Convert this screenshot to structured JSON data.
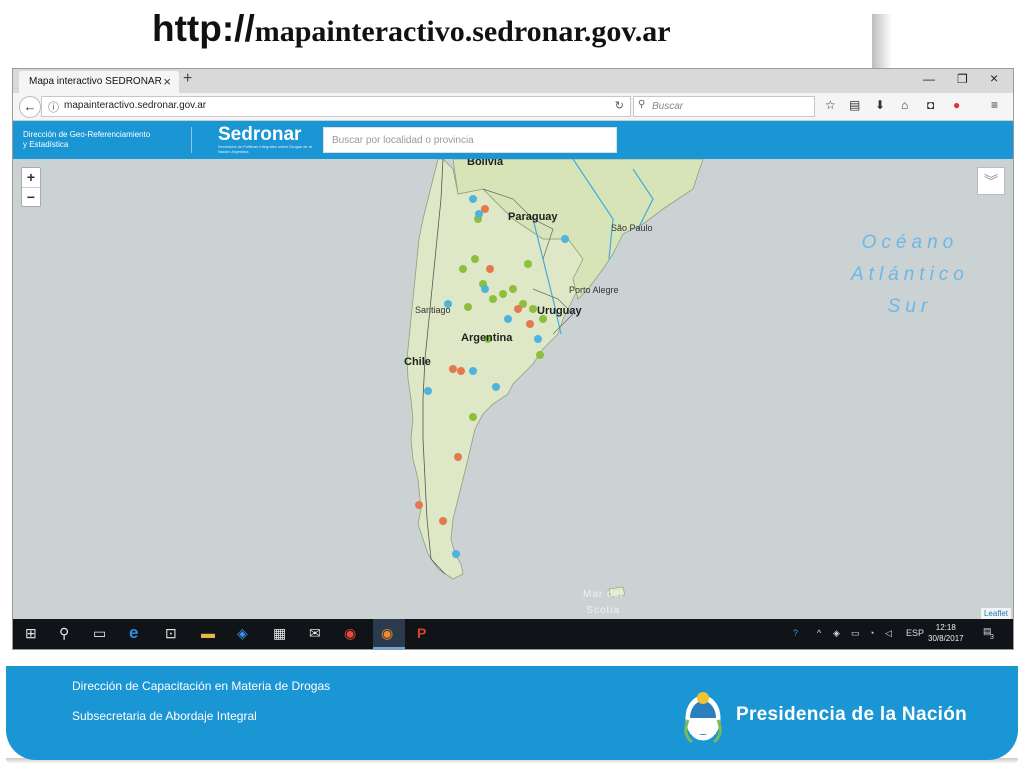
{
  "slide": {
    "title_prefix": "http://",
    "title_url": "mapainteractivo.sedronar.gov.ar"
  },
  "browser": {
    "tab_title": "Mapa interactivo SEDRONAR",
    "tab_close": "×",
    "new_tab": "+",
    "window_controls": {
      "minimize": "—",
      "restore": "❐",
      "close": "×"
    },
    "url": "mapainteractivo.sedronar.gov.ar",
    "search_placeholder": "Buscar"
  },
  "site": {
    "header_left_line1": "Dirección de Geo-Referenciamiento",
    "header_left_line2": "y Estadística",
    "logo": "Sedronar",
    "logo_subtitle": "Secretaría de Políticas Integrales sobre Drogas de la Nación Argentina",
    "search_placeholder": "Buscar por localidad o provincia"
  },
  "map": {
    "zoom_in": "+",
    "zoom_out": "−",
    "ocean_line1": "Océano",
    "ocean_line2": "Atlántico",
    "ocean_line3": "Sur",
    "mar_line1": "Mar del",
    "mar_line2": "Scotia",
    "attribution": "Leaflet",
    "places": {
      "bolivia": "Bolivia",
      "paraguay": "Paraguay",
      "sao_paulo": "São Paulo",
      "porto_alegre": "Porto Alegre",
      "uruguay": "Uruguay",
      "santiago": "Santiago",
      "argentina": "Argentina",
      "chile": "Chile"
    },
    "marker_colors": {
      "green": "#8bbf3c",
      "blue": "#4fb3e0",
      "orange": "#e27a4e"
    }
  },
  "taskbar": {
    "tray_lang": "ESP",
    "time": "12:18",
    "date": "30/8/2017",
    "notif_count": "3"
  },
  "footer": {
    "line1": "Dirección de Capacitación en Materia de Drogas",
    "line2": "Subsecretaria de Abordaje Integral",
    "brand": "Presidencia de la Nación"
  }
}
